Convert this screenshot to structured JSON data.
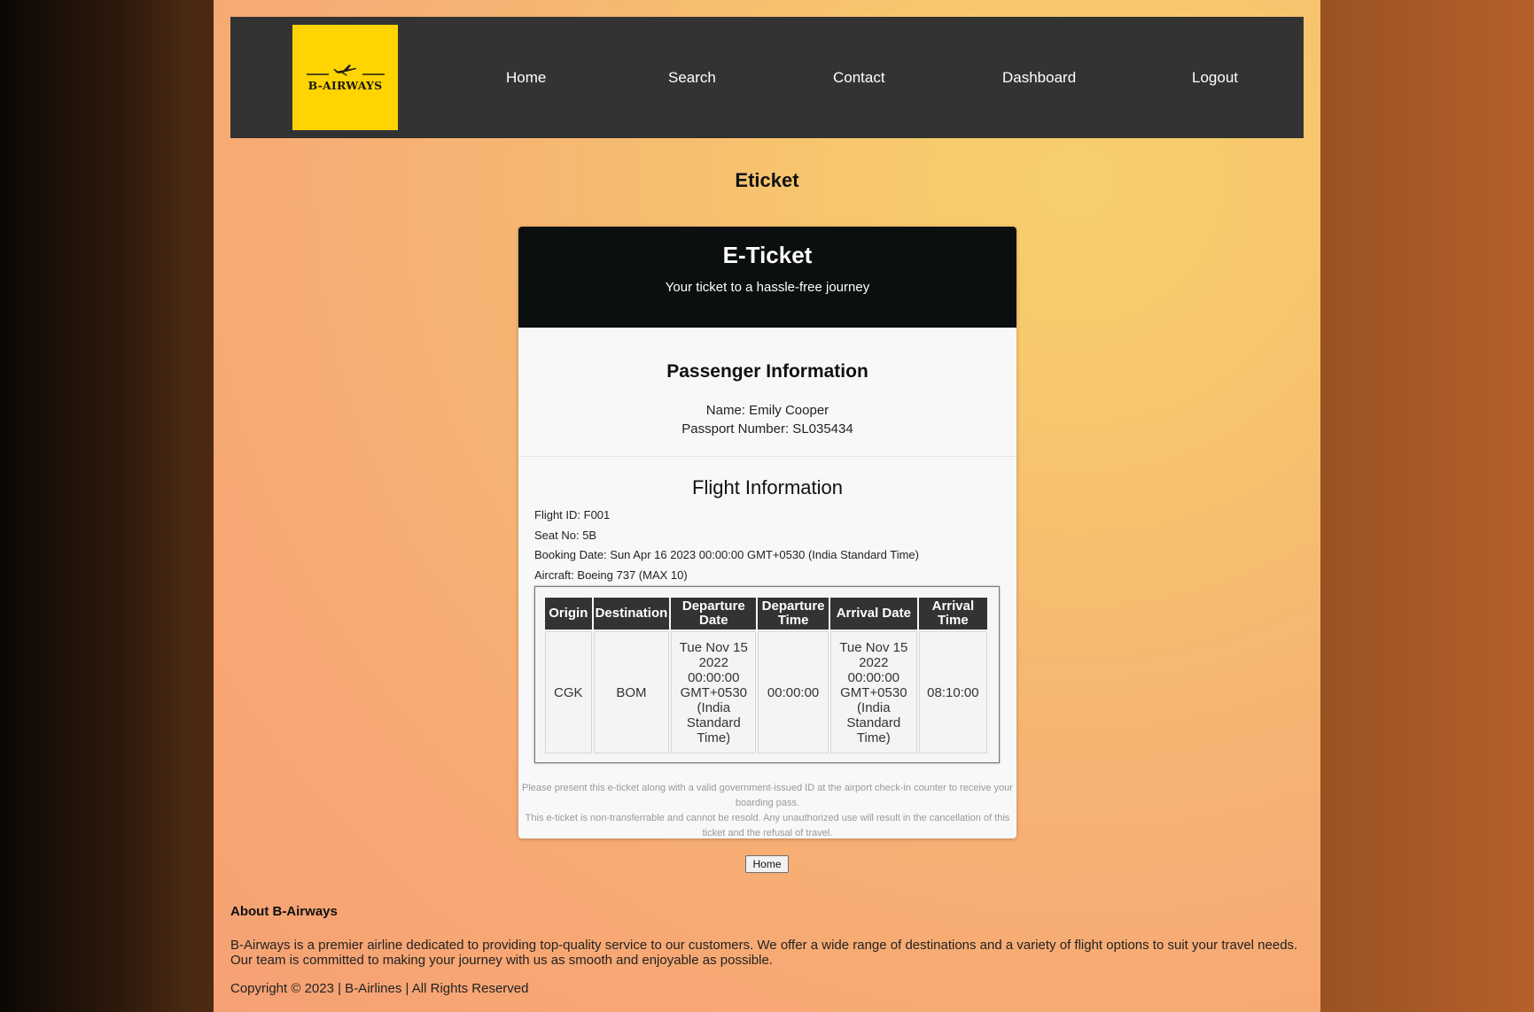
{
  "logo": {
    "text": "B-AIRWAYS",
    "bg_color": "#ffd400"
  },
  "nav": {
    "home": "Home",
    "search": "Search",
    "contact": "Contact",
    "dashboard": "Dashboard",
    "logout": "Logout"
  },
  "page_title": "Eticket",
  "ticket": {
    "title": "E-Ticket",
    "subtitle": "Your ticket to a hassle-free journey",
    "passenger_heading": "Passenger Information",
    "name_line": "Name: Emily Cooper",
    "passport_line": "Passport Number: SL035434",
    "flight_heading": "Flight Information",
    "flight_id_line": "Flight ID: F001",
    "seat_line": "Seat No: 5B",
    "booking_line": "Booking Date: Sun Apr 16 2023 00:00:00 GMT+0530 (India Standard Time)",
    "aircraft_line": "Aircraft: Boeing 737 (MAX 10)",
    "table": {
      "headers": [
        "Origin",
        "Destination",
        "Departure Date",
        "Departure Time",
        "Arrival Date",
        "Arrival Time"
      ],
      "row": [
        "CGK",
        "BOM",
        "Tue Nov 15 2022 00:00:00 GMT+0530 (India Standard Time)",
        "00:00:00",
        "Tue Nov 15 2022 00:00:00 GMT+0530 (India Standard Time)",
        "08:10:00"
      ]
    },
    "note1": "Please present this e-ticket along with a valid government-issued ID at the airport check-in counter to receive your boarding pass.",
    "note2": "This e-ticket is non-transferrable and cannot be resold. Any unauthorized use will result in the cancellation of this ticket and the refusal of travel."
  },
  "home_button": "Home",
  "footer": {
    "about_title": "About B-Airways",
    "about_text": "B-Airways is a premier airline dedicated to providing top-quality service to our customers. We offer a wide range of destinations and a variety of flight options to suit your travel needs. Our team is committed to making your journey with us as smooth and enjoyable as possible.",
    "copyright": "Copyright © 2023 | B-Airlines | All Rights Reserved"
  }
}
